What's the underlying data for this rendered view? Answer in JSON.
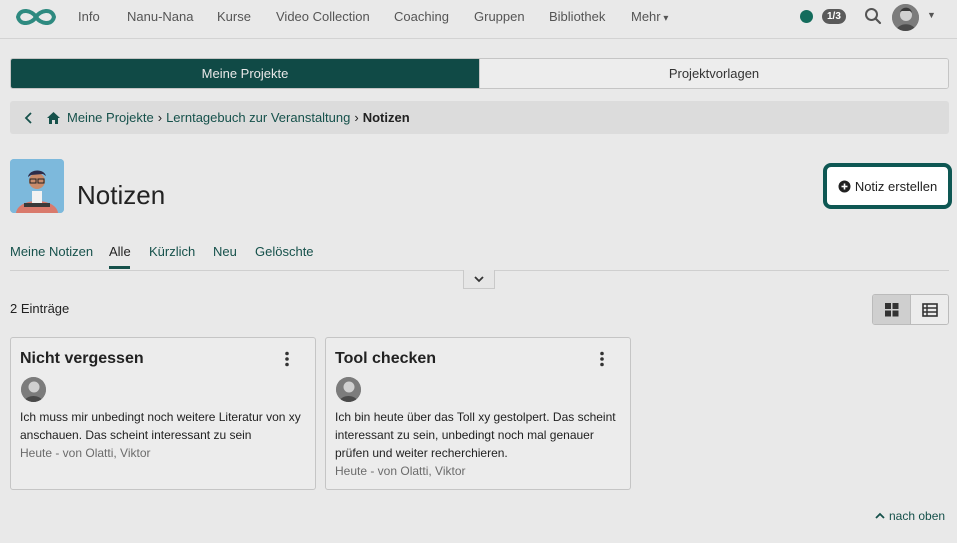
{
  "nav": {
    "items": [
      "Info",
      "Nanu-Nana",
      "Kurse",
      "Video Collection",
      "Coaching",
      "Gruppen",
      "Bibliothek",
      "Mehr"
    ],
    "badge": "1/3",
    "status_color": "#146c5c"
  },
  "segments": {
    "active": "Meine Projekte",
    "inactive": "Projektvorlagen"
  },
  "breadcrumb": {
    "items": [
      "Meine Projekte",
      "Lerntagebuch zur Veranstaltung"
    ],
    "current": "Notizen"
  },
  "page": {
    "title": "Notizen",
    "create_label": "Notiz erstellen"
  },
  "tabs": [
    "Meine Notizen",
    "Alle",
    "Kürzlich",
    "Neu",
    "Gelöschte"
  ],
  "active_tab": "Alle",
  "count_label": "2 Einträge",
  "cards": [
    {
      "title": "Nicht vergessen",
      "text": "Ich muss mir unbedingt noch weitere Literatur von xy anschauen. Das scheint interessant zu sein",
      "meta": "Heute - von Olatti, Viktor"
    },
    {
      "title": "Tool checken",
      "text": "Ich bin heute über das Toll xy gestolpert. Das scheint interessant zu sein, unbedingt noch mal genauer prüfen und weiter recherchieren.",
      "meta": "Heute - von Olatti, Viktor"
    }
  ],
  "to_top_label": "nach oben",
  "colors": {
    "accent": "#104a46",
    "link": "#16514b",
    "highlight_border": "#0e5753"
  }
}
